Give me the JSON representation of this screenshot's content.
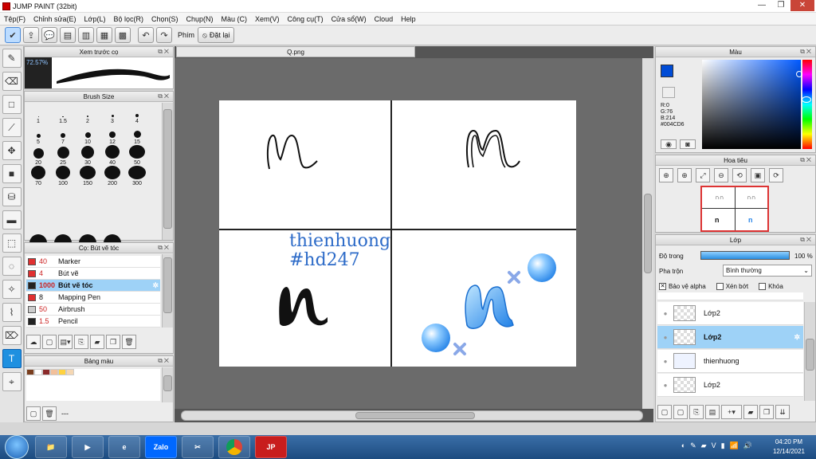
{
  "window": {
    "title": "JUMP PAINT (32bit)"
  },
  "menu": [
    "Tệp(F)",
    "Chỉnh sửa(E)",
    "Lớp(L)",
    "Bộ lọc(R)",
    "Chọn(S)",
    "Chụp(N)",
    "Màu (C)",
    "Xem(V)",
    "Công cụ(T)",
    "Cửa sổ(W)",
    "Cloud",
    "Help"
  ],
  "toolbar": {
    "keys_label": "Phím",
    "reset_label": "Đặt lại"
  },
  "brush_preview": {
    "title": "Xem trước cọ",
    "percent": "72.57%"
  },
  "brush_size": {
    "title": "Brush Size",
    "sizes": [
      "1",
      "1.5",
      "2",
      "3",
      "4",
      "5",
      "7",
      "10",
      "12",
      "15",
      "20",
      "25",
      "30",
      "40",
      "50",
      "70",
      "100",
      "150",
      "200",
      "300"
    ]
  },
  "brush_list": {
    "title": "Cọ: Bút vẽ tóc",
    "items": [
      {
        "size": "40",
        "name": "Marker",
        "color": "#e03030"
      },
      {
        "size": "4",
        "name": "Bút vẽ",
        "color": "#e03030"
      },
      {
        "size": "1000",
        "name": "Bút vẽ tóc",
        "color": "#222222"
      },
      {
        "size": "8",
        "name": "Mapping Pen",
        "color": "#e03030"
      },
      {
        "size": "50",
        "name": "Airbrush",
        "color": "#cccccc"
      },
      {
        "size": "1.5",
        "name": "Pencil",
        "color": "#222222"
      }
    ]
  },
  "palette": {
    "title": "Bảng màu",
    "footer": "---",
    "colors": [
      "#7a3e1e",
      "#ffffff",
      "#8b2a2a",
      "#f2c09a",
      "#ffd23f",
      "#f5d7b3"
    ]
  },
  "document": {
    "tab": "Q.png",
    "watermark_line1": "thienhuong",
    "watermark_line2": "#hd247"
  },
  "color_panel": {
    "title": "Màu",
    "r": "R:0",
    "g": "G:76",
    "b": "B:214",
    "hex": "#004CD6"
  },
  "navigator": {
    "title": "Hoa tiêu"
  },
  "layers": {
    "title": "Lớp",
    "opacity_label": "Độ trong",
    "opacity_value": "100 %",
    "blend_label": "Pha trộn",
    "blend_value": "Bình thường",
    "protect_alpha": "Bảo vệ alpha",
    "clipping": "Xén bớt",
    "lock": "Khóa",
    "items": [
      "Lớp2",
      "Lớp2",
      "thienhuong",
      "Lớp2"
    ]
  },
  "taskbar": {
    "time": "04:20 PM",
    "date": "12/14/2021",
    "apps": [
      "Zalo",
      "Chrome",
      "Jump Paint"
    ]
  }
}
